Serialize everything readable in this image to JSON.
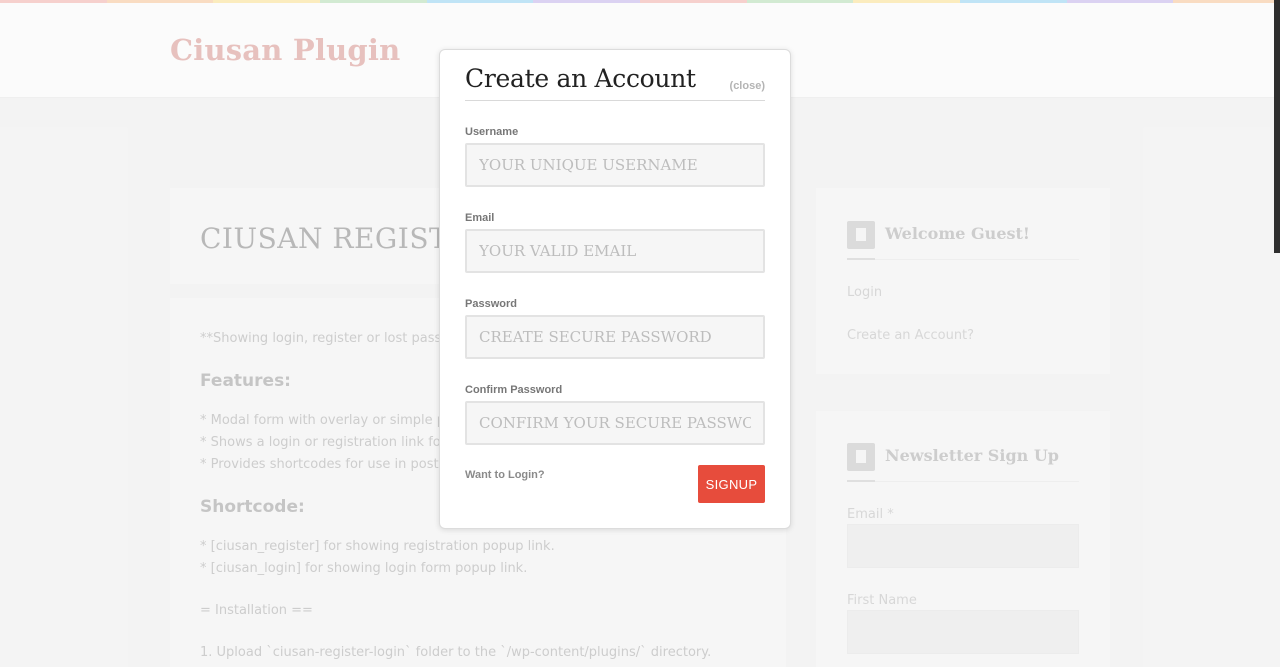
{
  "site": {
    "title": "Ciusan Plugin"
  },
  "page": {
    "title": "CIUSAN REGISTER LOGIN",
    "intro": "**Showing login, register or lost password in modal form.",
    "features_heading": "Features:",
    "features": [
      "* Modal form with overlay or simple popup.",
      "* Shows a login or registration link for not logged users.",
      "* Provides shortcodes for use in posts and pages."
    ],
    "shortcode_heading": "Shortcode:",
    "shortcodes": [
      "* [ciusan_register] for showing registration popup link.",
      "* [ciusan_login] for showing login form popup link."
    ],
    "installation_heading": "= Installation ==",
    "installation_step": "1. Upload `ciusan-register-login` folder to the `/wp-content/plugins/` directory."
  },
  "sidebar": {
    "welcome": {
      "title": "Welcome Guest!",
      "login_link": "Login",
      "register_link": "Create an Account?"
    },
    "newsletter": {
      "title": "Newsletter Sign Up",
      "email_label": "Email *",
      "first_name_label": "First Name"
    }
  },
  "modal": {
    "title": "Create an Account",
    "close_label": "(close)",
    "fields": {
      "username": {
        "label": "Username",
        "placeholder": "YOUR UNIQUE USERNAME"
      },
      "email": {
        "label": "Email",
        "placeholder": "YOUR VALID EMAIL"
      },
      "password": {
        "label": "Password",
        "placeholder": "CREATE SECURE PASSWORD"
      },
      "confirm_password": {
        "label": "Confirm Password",
        "placeholder": "CONFIRM YOUR SECURE PASSWORD"
      }
    },
    "login_link": "Want to Login?",
    "signup_label": "SIGNUP"
  },
  "colors": {
    "accent": "#e74c3c",
    "site_title": "#e2b4b0",
    "top_stripe": [
      "#f5c6c2",
      "#f8d5b5",
      "#fae8b0",
      "#c8e6c9",
      "#b3dff5",
      "#d4c8ef",
      "#f5c6c2",
      "#c8e6c9",
      "#fae8b0",
      "#b3dff5",
      "#d4c8ef",
      "#f8d5b5"
    ]
  }
}
